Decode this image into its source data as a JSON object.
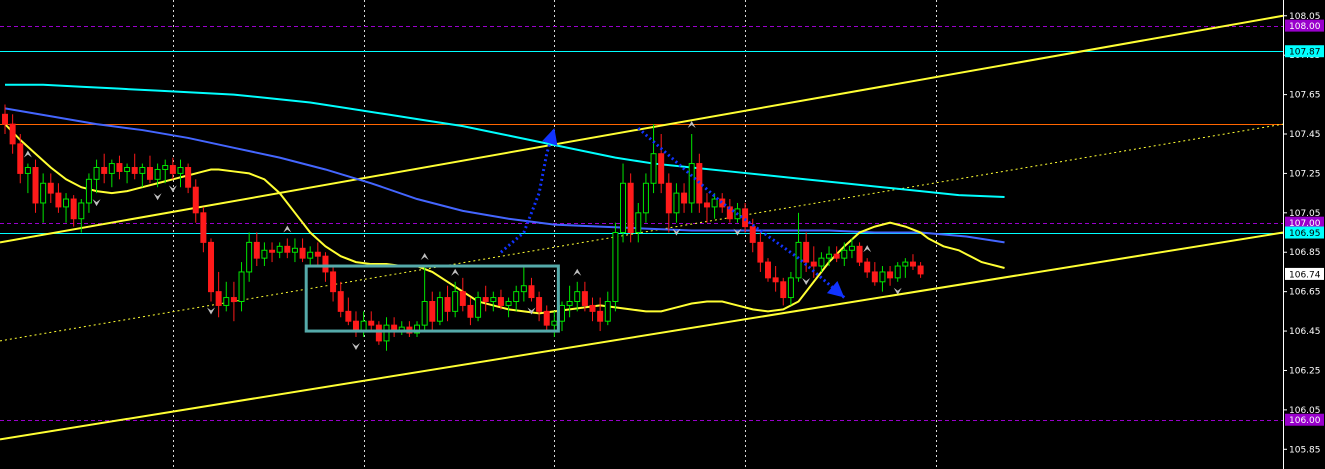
{
  "chart_data": {
    "type": "line",
    "subtype": "candlestick",
    "grid": true,
    "background": "#000000",
    "colors": {
      "bull": "#00e600",
      "bear": "#ff1a1a",
      "ma_fast": "#ffff33",
      "ma_mid": "#00ffff",
      "ma_slow": "#4466ff",
      "channel": "#ffff33",
      "resistance": "#ff6600",
      "support_resistance_cyan": "#00ffff",
      "level_purple": "#9900cc",
      "arrow": "#1133ff",
      "box": "#55aaaa",
      "fractal": "#bfbfbf"
    },
    "ylim": [
      105.75,
      108.13
    ],
    "yticks": [
      "108.05",
      "107.85",
      "107.65",
      "107.45",
      "107.25",
      "107.05",
      "106.85",
      "106.65",
      "106.45",
      "106.25",
      "106.05",
      "105.85"
    ],
    "price_tags": [
      {
        "label": "108.00",
        "value": 108.0,
        "bg": "#9900cc",
        "fg": "#ffffff"
      },
      {
        "label": "107.87",
        "value": 107.87,
        "bg": "#00ffff",
        "fg": "#000000"
      },
      {
        "label": "107.00",
        "value": 107.0,
        "bg": "#9900cc",
        "fg": "#ffffff"
      },
      {
        "label": "106.95",
        "value": 106.95,
        "bg": "#00ffff",
        "fg": "#000000"
      },
      {
        "label": "106.74",
        "value": 106.74,
        "bg": "#ffffff",
        "fg": "#000000"
      },
      {
        "label": "106.00",
        "value": 106.0,
        "bg": "#9900cc",
        "fg": "#ffffff"
      }
    ],
    "horizontal_lines": [
      {
        "value": 108.0,
        "color": "#9900cc",
        "style": "dash"
      },
      {
        "value": 107.87,
        "color": "#00ffff",
        "style": "solid"
      },
      {
        "value": 107.5,
        "color": "#ff6600",
        "style": "solid"
      },
      {
        "value": 107.0,
        "color": "#9900cc",
        "style": "dash"
      },
      {
        "value": 106.95,
        "color": "#00ffff",
        "style": "solid"
      },
      {
        "value": 106.0,
        "color": "#9900cc",
        "style": "dash"
      }
    ],
    "candles": [
      [
        107.55,
        107.6,
        107.45,
        107.5
      ],
      [
        107.5,
        107.55,
        107.35,
        107.4
      ],
      [
        107.4,
        107.45,
        107.2,
        107.25
      ],
      [
        107.25,
        107.3,
        107.15,
        107.28
      ],
      [
        107.28,
        107.32,
        107.05,
        107.1
      ],
      [
        107.1,
        107.25,
        107.0,
        107.2
      ],
      [
        107.2,
        107.25,
        107.1,
        107.15
      ],
      [
        107.15,
        107.2,
        107.05,
        107.08
      ],
      [
        107.08,
        107.15,
        107.0,
        107.12
      ],
      [
        107.12,
        107.14,
        106.98,
        107.02
      ],
      [
        107.02,
        107.12,
        106.95,
        107.1
      ],
      [
        107.1,
        107.25,
        107.05,
        107.22
      ],
      [
        107.22,
        107.32,
        107.15,
        107.28
      ],
      [
        107.28,
        107.35,
        107.2,
        107.25
      ],
      [
        107.25,
        107.32,
        107.18,
        107.3
      ],
      [
        107.3,
        107.34,
        107.22,
        107.26
      ],
      [
        107.26,
        107.3,
        107.2,
        107.28
      ],
      [
        107.28,
        107.35,
        107.22,
        107.25
      ],
      [
        107.25,
        107.3,
        107.18,
        107.28
      ],
      [
        107.28,
        107.34,
        107.2,
        107.22
      ],
      [
        107.22,
        107.3,
        107.18,
        107.27
      ],
      [
        107.27,
        107.32,
        107.2,
        107.29
      ],
      [
        107.29,
        107.33,
        107.22,
        107.25
      ],
      [
        107.25,
        107.32,
        107.18,
        107.28
      ],
      [
        107.28,
        107.3,
        107.15,
        107.18
      ],
      [
        107.18,
        107.22,
        107.0,
        107.05
      ],
      [
        107.05,
        107.08,
        106.85,
        106.9
      ],
      [
        106.9,
        106.92,
        106.6,
        106.65
      ],
      [
        106.65,
        106.75,
        106.52,
        106.58
      ],
      [
        106.58,
        106.7,
        106.55,
        106.62
      ],
      [
        106.62,
        106.7,
        106.5,
        106.6
      ],
      [
        106.6,
        106.8,
        106.55,
        106.75
      ],
      [
        106.75,
        106.95,
        106.7,
        106.9
      ],
      [
        106.9,
        106.95,
        106.78,
        106.82
      ],
      [
        106.82,
        106.9,
        106.78,
        106.86
      ],
      [
        106.86,
        106.9,
        106.8,
        106.85
      ],
      [
        106.85,
        106.9,
        106.82,
        106.88
      ],
      [
        106.88,
        106.92,
        106.82,
        106.85
      ],
      [
        106.85,
        106.92,
        106.8,
        106.87
      ],
      [
        106.87,
        106.92,
        106.8,
        106.82
      ],
      [
        106.82,
        106.88,
        106.78,
        106.85
      ],
      [
        106.85,
        106.9,
        106.78,
        106.83
      ],
      [
        106.83,
        106.85,
        106.7,
        106.75
      ],
      [
        106.75,
        106.78,
        106.6,
        106.65
      ],
      [
        106.65,
        106.7,
        106.52,
        106.55
      ],
      [
        106.55,
        106.62,
        106.48,
        106.5
      ],
      [
        106.5,
        106.55,
        106.42,
        106.45
      ],
      [
        106.45,
        106.55,
        106.42,
        106.5
      ],
      [
        106.5,
        106.55,
        106.45,
        106.48
      ],
      [
        106.48,
        106.5,
        106.38,
        106.4
      ],
      [
        106.4,
        106.52,
        106.35,
        106.48
      ],
      [
        106.48,
        106.52,
        106.42,
        106.45
      ],
      [
        106.45,
        106.5,
        106.43,
        106.47
      ],
      [
        106.47,
        106.5,
        106.42,
        106.44
      ],
      [
        106.44,
        106.5,
        106.42,
        106.48
      ],
      [
        106.48,
        106.78,
        106.45,
        106.6
      ],
      [
        106.6,
        106.65,
        106.45,
        106.5
      ],
      [
        106.5,
        106.65,
        106.48,
        106.62
      ],
      [
        106.62,
        106.68,
        106.5,
        106.55
      ],
      [
        106.55,
        106.7,
        106.52,
        106.65
      ],
      [
        106.65,
        106.72,
        106.55,
        106.58
      ],
      [
        106.58,
        106.62,
        106.48,
        106.52
      ],
      [
        106.52,
        106.65,
        106.5,
        106.62
      ],
      [
        106.62,
        106.68,
        106.55,
        106.6
      ],
      [
        106.6,
        106.65,
        106.55,
        106.62
      ],
      [
        106.62,
        106.66,
        106.56,
        106.58
      ],
      [
        106.58,
        106.62,
        106.52,
        106.6
      ],
      [
        106.6,
        106.68,
        106.55,
        106.65
      ],
      [
        106.65,
        106.78,
        106.6,
        106.68
      ],
      [
        106.68,
        106.72,
        106.6,
        106.62
      ],
      [
        106.62,
        106.65,
        106.5,
        106.55
      ],
      [
        106.55,
        106.58,
        106.45,
        106.48
      ],
      [
        106.48,
        106.55,
        106.42,
        106.5
      ],
      [
        106.5,
        106.6,
        106.45,
        106.58
      ],
      [
        106.58,
        106.68,
        106.52,
        106.6
      ],
      [
        106.6,
        106.7,
        106.55,
        106.65
      ],
      [
        106.65,
        106.7,
        106.55,
        106.58
      ],
      [
        106.58,
        106.62,
        106.5,
        106.55
      ],
      [
        106.55,
        106.62,
        106.45,
        106.5
      ],
      [
        106.5,
        106.65,
        106.48,
        106.6
      ],
      [
        106.6,
        107.0,
        106.55,
        106.95
      ],
      [
        106.95,
        107.3,
        106.9,
        107.2
      ],
      [
        107.2,
        107.25,
        106.9,
        106.95
      ],
      [
        106.95,
        107.1,
        106.9,
        107.05
      ],
      [
        107.05,
        107.25,
        107.0,
        107.2
      ],
      [
        107.2,
        107.5,
        107.15,
        107.35
      ],
      [
        107.35,
        107.45,
        107.15,
        107.2
      ],
      [
        107.2,
        107.25,
        106.95,
        107.05
      ],
      [
        107.05,
        107.2,
        107.0,
        107.15
      ],
      [
        107.15,
        107.2,
        107.05,
        107.1
      ],
      [
        107.1,
        107.45,
        107.05,
        107.3
      ],
      [
        107.3,
        107.35,
        107.05,
        107.1
      ],
      [
        107.1,
        107.15,
        107.0,
        107.08
      ],
      [
        107.08,
        107.15,
        107.02,
        107.12
      ],
      [
        107.12,
        107.15,
        107.05,
        107.08
      ],
      [
        107.08,
        107.12,
        107.0,
        107.02
      ],
      [
        107.02,
        107.1,
        107.0,
        107.07
      ],
      [
        107.07,
        107.1,
        106.95,
        106.98
      ],
      [
        106.98,
        107.02,
        106.85,
        106.9
      ],
      [
        106.9,
        106.95,
        106.75,
        106.8
      ],
      [
        106.8,
        106.82,
        106.7,
        106.72
      ],
      [
        106.72,
        106.78,
        106.65,
        106.7
      ],
      [
        106.7,
        106.72,
        106.58,
        106.62
      ],
      [
        106.62,
        106.75,
        106.58,
        106.72
      ],
      [
        106.72,
        107.05,
        106.7,
        106.9
      ],
      [
        106.9,
        106.95,
        106.75,
        106.8
      ],
      [
        106.8,
        106.88,
        106.72,
        106.78
      ],
      [
        106.78,
        106.85,
        106.75,
        106.82
      ],
      [
        106.82,
        106.88,
        106.78,
        106.84
      ],
      [
        106.84,
        106.88,
        106.8,
        106.82
      ],
      [
        106.82,
        106.9,
        106.78,
        106.86
      ],
      [
        106.86,
        106.92,
        106.82,
        106.88
      ],
      [
        106.88,
        106.9,
        106.78,
        106.8
      ],
      [
        106.8,
        106.82,
        106.72,
        106.75
      ],
      [
        106.75,
        106.8,
        106.68,
        106.7
      ],
      [
        106.7,
        106.78,
        106.65,
        106.75
      ],
      [
        106.75,
        106.78,
        106.68,
        106.72
      ],
      [
        106.72,
        106.8,
        106.7,
        106.78
      ],
      [
        106.78,
        106.82,
        106.72,
        106.8
      ],
      [
        106.8,
        106.84,
        106.76,
        106.78
      ],
      [
        106.78,
        106.8,
        106.72,
        106.74
      ]
    ],
    "ma_fast": [
      107.5,
      107.42,
      107.35,
      107.28,
      107.22,
      107.18,
      107.16,
      107.15,
      107.16,
      107.18,
      107.2,
      107.22,
      107.24,
      107.25,
      107.26,
      107.27,
      107.27,
      107.26,
      107.25,
      107.22,
      107.15,
      107.05,
      106.95,
      106.88,
      106.83,
      106.8,
      106.79,
      106.79,
      106.78,
      106.78,
      106.75,
      106.7,
      106.65,
      106.6,
      106.58,
      106.56,
      106.55,
      106.54,
      106.55,
      106.56,
      106.57,
      106.58,
      106.57,
      106.56,
      106.55,
      106.55,
      106.57,
      106.59,
      106.6,
      106.6,
      106.58,
      106.56,
      106.55,
      106.56,
      106.6,
      106.7,
      106.8,
      106.88,
      106.95,
      106.98,
      107.0,
      106.98,
      106.95,
      106.92,
      106.9,
      106.88,
      106.87,
      106.86,
      106.84,
      106.82,
      106.8,
      106.79,
      106.78,
      106.77
    ],
    "ma_fast_x": [
      0,
      2,
      4,
      6,
      8,
      10,
      12,
      14,
      16,
      18,
      20,
      22,
      24,
      25,
      26,
      27,
      28,
      30,
      32,
      34,
      36,
      38,
      40,
      42,
      44,
      46,
      48,
      50,
      52,
      54,
      56,
      58,
      60,
      62,
      64,
      66,
      68,
      70,
      72,
      74,
      76,
      78,
      80,
      82,
      84,
      86,
      88,
      90,
      92,
      94,
      96,
      98,
      100,
      102,
      104,
      106,
      108,
      110,
      112,
      114,
      116,
      118,
      120,
      121,
      122,
      123,
      124,
      125,
      126,
      127,
      128,
      129,
      130,
      131
    ],
    "ma_mid": [
      107.7,
      107.7,
      107.69,
      107.68,
      107.67,
      107.66,
      107.65,
      107.63,
      107.61,
      107.58,
      107.55,
      107.52,
      107.49,
      107.45,
      107.41,
      107.37,
      107.33,
      107.3,
      107.28,
      107.26,
      107.24,
      107.22,
      107.2,
      107.18,
      107.16,
      107.14,
      107.13
    ],
    "ma_mid_x": [
      0,
      5,
      10,
      15,
      20,
      25,
      30,
      35,
      40,
      45,
      50,
      55,
      60,
      65,
      70,
      75,
      80,
      85,
      90,
      95,
      100,
      105,
      110,
      115,
      120,
      125,
      131
    ],
    "ma_slow": [
      107.58,
      107.54,
      107.5,
      107.47,
      107.43,
      107.38,
      107.33,
      107.27,
      107.2,
      107.12,
      107.06,
      107.02,
      106.99,
      106.98,
      106.97,
      106.96,
      106.96,
      106.96,
      106.96,
      106.95,
      106.95,
      106.93,
      106.9
    ],
    "ma_slow_x": [
      0,
      6,
      12,
      18,
      24,
      30,
      36,
      42,
      48,
      54,
      60,
      66,
      72,
      78,
      84,
      90,
      96,
      102,
      108,
      114,
      120,
      126,
      131
    ],
    "channel_lines": [
      {
        "x1": 0,
        "y1": 106.9,
        "x2": 131,
        "y2": 108.05,
        "style": "solid"
      },
      {
        "x1": 0,
        "y1": 105.9,
        "x2": 131,
        "y2": 106.95,
        "style": "solid"
      },
      {
        "x1": 0,
        "y1": 106.4,
        "x2": 131,
        "y2": 107.5,
        "style": "dotted"
      }
    ],
    "annotations": [
      {
        "type": "box",
        "x1": 40,
        "x2": 72,
        "y1": 106.78,
        "y2": 106.45
      },
      {
        "type": "arrow",
        "path_x": [
          65,
          68,
          70,
          71,
          72
        ],
        "path_y": [
          106.85,
          106.95,
          107.15,
          107.35,
          107.48
        ]
      },
      {
        "type": "arrow",
        "path_x": [
          83,
          94,
          104,
          110
        ],
        "path_y": [
          107.48,
          107.1,
          106.82,
          106.62
        ]
      }
    ]
  }
}
